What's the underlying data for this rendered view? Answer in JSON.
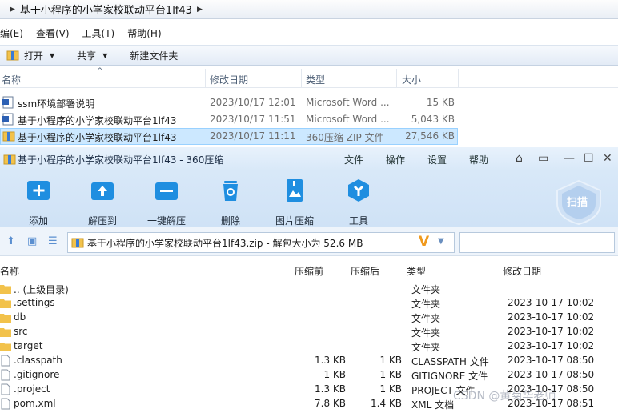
{
  "explorer": {
    "breadcrumb": "基于小程序的小学家校联动平台1lf43",
    "menu": [
      "编(E)",
      "查看(V)",
      "工具(T)",
      "帮助(H)"
    ],
    "toolbar": {
      "open": "打开",
      "share": "共享",
      "new_folder": "新建文件夹"
    },
    "columns": {
      "name": "名称",
      "date": "修改日期",
      "type": "类型",
      "size": "大小"
    },
    "files": [
      {
        "name": "ssm环境部署说明",
        "date": "2023/10/17 12:01",
        "type": "Microsoft Word ...",
        "size": "15 KB"
      },
      {
        "name": "基于小程序的小学家校联动平台1lf43",
        "date": "2023/10/17 11:51",
        "type": "Microsoft Word ...",
        "size": "5,043 KB"
      },
      {
        "name": "基于小程序的小学家校联动平台1lf43",
        "date": "2023/10/17 11:11",
        "type": "360压缩 ZIP 文件",
        "size": "27,546 KB"
      }
    ]
  },
  "zip": {
    "title": "基于小程序的小学家校联动平台1lf43 - 360压缩",
    "menu": {
      "file": "文件",
      "action": "操作",
      "settings": "设置",
      "help": "帮助"
    },
    "tools": {
      "add": "添加",
      "extract_to": "解压到",
      "one_click": "一键解压",
      "delete": "删除",
      "image_compress": "图片压缩",
      "tools": "工具"
    },
    "scan": "扫描",
    "path": "基于小程序的小学家校联动平台1lf43.zip - 解包大小为 52.6 MB",
    "columns": {
      "name": "名称",
      "before": "压缩前",
      "after": "压缩后",
      "type": "类型",
      "modified": "修改日期"
    },
    "entries": [
      {
        "name": ".. (上级目录)",
        "before": "",
        "after": "",
        "type": "文件夹",
        "modified": ""
      },
      {
        "name": ".settings",
        "before": "",
        "after": "",
        "type": "文件夹",
        "modified": "2023-10-17 10:02"
      },
      {
        "name": "db",
        "before": "",
        "after": "",
        "type": "文件夹",
        "modified": "2023-10-17 10:02"
      },
      {
        "name": "src",
        "before": "",
        "after": "",
        "type": "文件夹",
        "modified": "2023-10-17 10:02"
      },
      {
        "name": "target",
        "before": "",
        "after": "",
        "type": "文件夹",
        "modified": "2023-10-17 10:02"
      },
      {
        "name": ".classpath",
        "before": "1.3 KB",
        "after": "1 KB",
        "type": "CLASSPATH 文件",
        "modified": "2023-10-17 08:50"
      },
      {
        "name": ".gitignore",
        "before": "1 KB",
        "after": "1 KB",
        "type": "GITIGNORE 文件",
        "modified": "2023-10-17 08:50"
      },
      {
        "name": ".project",
        "before": "1.3 KB",
        "after": "1 KB",
        "type": "PROJECT 文件",
        "modified": "2023-10-17 08:50"
      },
      {
        "name": "pom.xml",
        "before": "7.8 KB",
        "after": "1.4 KB",
        "type": "XML 文档",
        "modified": "2023-10-17 08:51"
      }
    ]
  },
  "watermark": "CSDN @黄菊华老师",
  "colors": {
    "accent": "#1f8ee0",
    "folder": "#f2c24b",
    "selection": "#cce8ff"
  }
}
